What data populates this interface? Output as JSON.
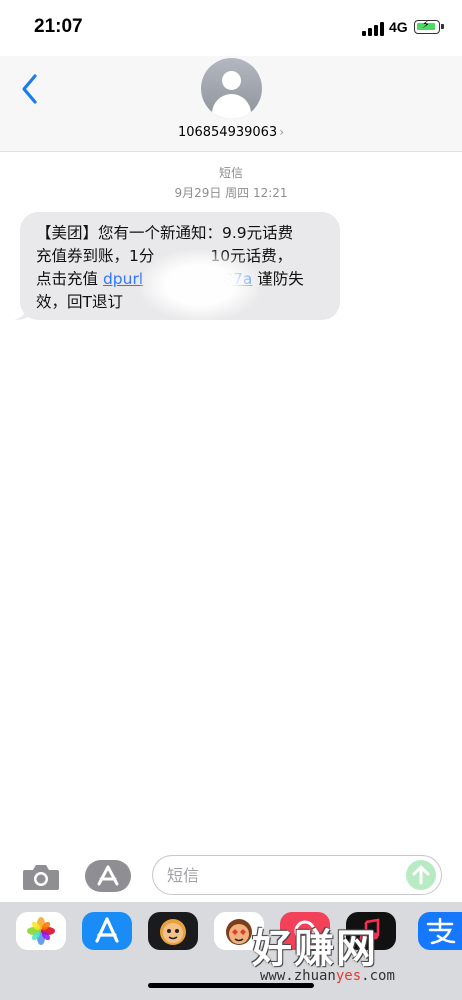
{
  "status_bar": {
    "time": "21:07",
    "network": "4G"
  },
  "header": {
    "contact_number": "106854939063",
    "chevron": "›"
  },
  "thread": {
    "service_label": "短信",
    "timestamp": "9月29日 周四 12:21",
    "message": {
      "line1": "【美团】您有一个新通知：9.9元话费",
      "line2": "充值券到账，1分",
      "line2_tail": "10元话费，",
      "line3_prefix": "点击充值 ",
      "link_start": "dpurl",
      "link_end": "87a",
      "line3_suffix": " 谨防失",
      "line4": "效，回T退订"
    }
  },
  "composer": {
    "placeholder": "短信",
    "value": ""
  },
  "app_drawer": {
    "apps": [
      "photos-icon",
      "app-store-icon",
      "memoji-icon",
      "memoji-stickers-icon",
      "red-app-icon",
      "music-app-icon",
      "alipay-icon"
    ]
  },
  "watermark": {
    "big_text": "好赚网",
    "small_prefix": "www.zhuan",
    "small_hl": "yes",
    "small_suffix": ".com"
  },
  "colors": {
    "link": "#3478f6",
    "bubble": "#e9e9eb",
    "send": "#b8ebc4",
    "back": "#1b7cf0"
  }
}
